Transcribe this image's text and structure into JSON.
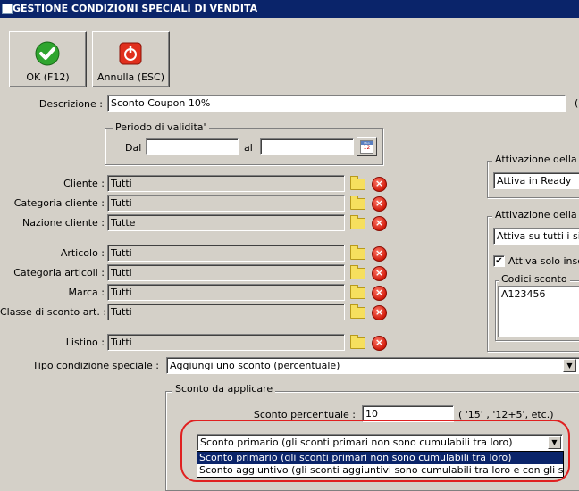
{
  "window": {
    "title": "GESTIONE CONDIZIONI SPECIALI DI VENDITA"
  },
  "toolbar": {
    "ok_label": "OK (F12)",
    "cancel_label": "Annulla (ESC)"
  },
  "form": {
    "descrizione_label": "Descrizione :",
    "descrizione_value": "Sconto Coupon 10%",
    "periodo_legend": "Periodo di validita'",
    "dal_label": "Dal",
    "dal_value": "",
    "al_label": "al",
    "al_value": "",
    "calendar_month": "Mon",
    "calendar_day": "12",
    "filters": [
      {
        "label": "Cliente :",
        "value": "Tutti"
      },
      {
        "label": "Categoria cliente :",
        "value": "Tutti"
      },
      {
        "label": "Nazione cliente :",
        "value": "Tutte"
      },
      {
        "label": "Articolo :",
        "value": "Tutti"
      },
      {
        "label": "Categoria articoli :",
        "value": "Tutti"
      },
      {
        "label": "Marca :",
        "value": "Tutti"
      },
      {
        "label": "Classe di sconto art. :",
        "value": "Tutti"
      },
      {
        "label": "Listino :",
        "value": "Tutti"
      }
    ],
    "tipo_label": "Tipo condizione speciale :",
    "tipo_value": "Aggiungi uno sconto (percentuale)",
    "sconto_legend": "Sconto da applicare",
    "sconto_perc_label": "Sconto percentuale :",
    "sconto_perc_value": "10",
    "sconto_perc_hint": "( '15' , '12+5', etc.)",
    "sconto_tipo_value": "Sconto primario (gli sconti primari non sono cumulabili tra loro)",
    "sconto_tipo_options": [
      "Sconto primario (gli sconti primari non sono cumulabili tra loro)",
      "Sconto aggiuntivo (gli sconti aggiuntivi sono cumulabili tra loro e con gli sconti primari)"
    ]
  },
  "right_panel": {
    "attivazione1_legend": "Attivazione della co",
    "attivazione1_value": "Attiva in Ready",
    "attivazione2_legend": "Attivazione della co",
    "attivazione2_value": "Attiva su tutti i siti e-",
    "solo_label": "Attiva solo insere",
    "solo_checked": "✔",
    "codici_legend": "Codici sconto",
    "codici_value": "A123456",
    "paren": "("
  },
  "annotation": {
    "color": "#e02020"
  }
}
